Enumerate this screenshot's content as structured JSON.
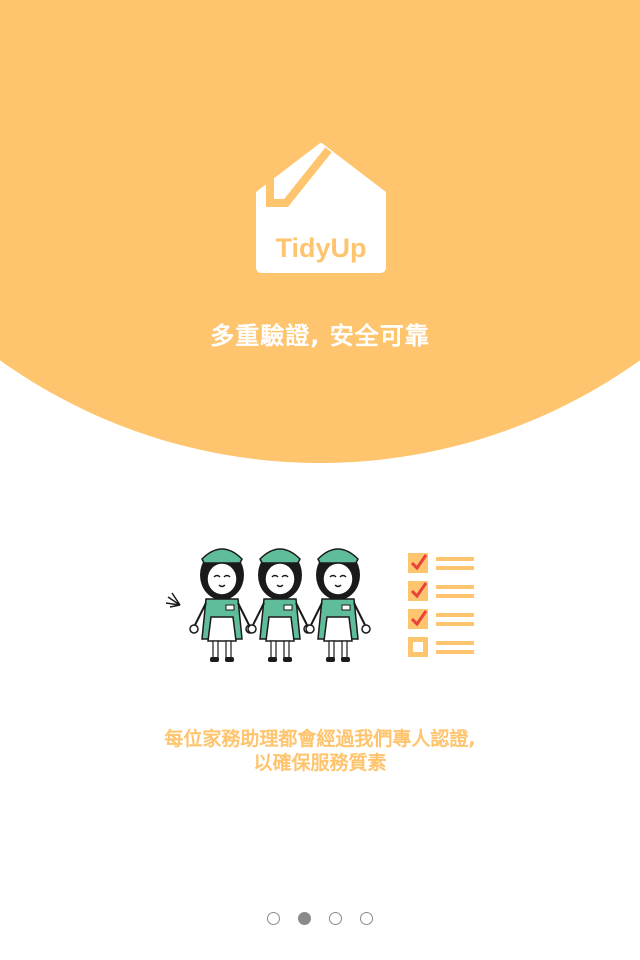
{
  "app": {
    "logo_text": "TidyUp"
  },
  "onboarding": {
    "headline": "多重驗證, 安全可靠",
    "description_line1": "每位家務助理都會經過我們專人認證,",
    "description_line2": "以確保服務質素",
    "illustration_icons": [
      "housekeeper-icon",
      "housekeeper-icon",
      "housekeeper-icon",
      "checklist-icon"
    ]
  },
  "pager": {
    "total_pages": 4,
    "active_page": 2
  },
  "colors": {
    "brand": "#FEC46E",
    "uniform": "#5FBE99",
    "check": "#E8423A",
    "dot": "#8a8a8a"
  }
}
